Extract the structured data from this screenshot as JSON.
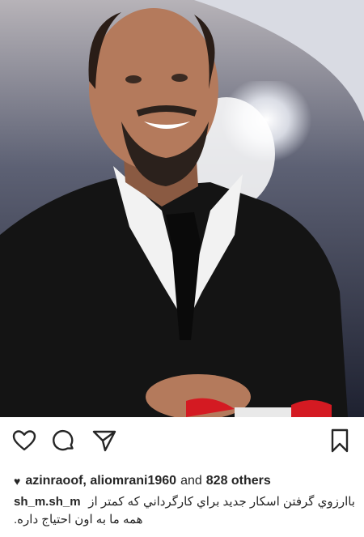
{
  "post": {
    "image_alt": "Smiling man in black suit and tie",
    "likes": {
      "user1": "azinraoof,",
      "user2": "aliomrani1960",
      "and": "and",
      "others": "828 others"
    },
    "caption": {
      "username": "sh_m.sh_m",
      "text_line1": "باارزوي گرفتن اسكار جديد براي كارگرداني كه كمتر از",
      "text_line2": ".همه ما به اون احتياج داره"
    }
  },
  "icons": {
    "like": "heart-outline-icon",
    "comment": "comment-bubble-icon",
    "share": "paper-plane-icon",
    "save": "bookmark-icon"
  }
}
